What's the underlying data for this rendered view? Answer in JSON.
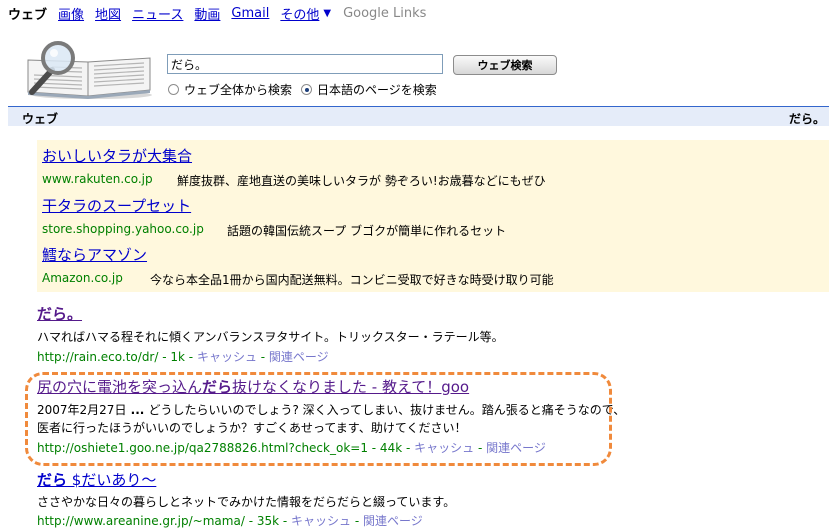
{
  "nav": {
    "items": [
      "ウェブ",
      "画像",
      "地図",
      "ニュース",
      "動画",
      "Gmail"
    ],
    "more": "その他",
    "google_links": "Google Links"
  },
  "search": {
    "query": "だら。",
    "button": "ウェブ検索",
    "radio_all": "ウェブ全体から検索",
    "radio_ja": "日本語のページを検索"
  },
  "section": {
    "label": "ウェブ",
    "right": "だら。 "
  },
  "ads": [
    {
      "title": "おいしいタラが大集合",
      "url": "www.rakuten.co.jp",
      "desc": "鮮度抜群、産地直送の美味しいタラが 勢ぞろい!お歳暮などにもぜひ"
    },
    {
      "title": "干タラのスープセット",
      "url": "store.shopping.yahoo.co.jp",
      "desc": "話題の韓国伝統スープ ブゴクが簡単に作れるセット"
    },
    {
      "title": "鱈ならアマゾン",
      "url": "Amazon.co.jp",
      "desc": "今なら本全品1冊から国内配送無料。コンビニ受取で好きな時受け取り可能"
    }
  ],
  "results": [
    {
      "title": "だら。",
      "snippet": "ハマればハマる程それに傾くアンバランスヲタサイト。トリックスター・ラテール等。",
      "url": "http://rain.eco.to/dr/",
      "size": " - 1k - ",
      "cache": "キャッシュ",
      "sep": " - ",
      "related": "関連ページ"
    },
    {
      "title_a": "尻の穴に電池を突っ込ん",
      "title_b": "だら",
      "title_c": "抜けなくなりました - 教えて！goo",
      "snippet_date": "2007年2月27日",
      "snippet_ellipsis": " ... ",
      "snippet_l1": "どうしたらいいのでしょう? 深く入ってしまい、抜けません。踏ん張ると痛そうなので、",
      "snippet_l2": "医者に行ったほうがいいのでしょうか？すごくあせってます、助けてください！",
      "url": "http://oshiete1.goo.ne.jp/qa2788826.html?check_ok=1",
      "size": " - 44k - ",
      "cache": "キャッシュ",
      "sep": " - ",
      "related": "関連ページ"
    },
    {
      "title_a": "だら",
      "title_b": " $だいあり～",
      "snippet": "ささやかな日々の暮らしとネットでみかけた情報をだらだらと綴っています。",
      "url": "http://www.areanine.gr.jp/~mama/",
      "size": " - 35k - ",
      "cache": "キャッシュ",
      "sep": " - ",
      "related": "関連ページ"
    }
  ],
  "colors": {
    "link": "#0000cc",
    "visited": "#551a8b",
    "url_green": "#008000",
    "ad_bg": "#fff8dd",
    "section_bg": "#e5ecf9",
    "highlight": "#f08a3c"
  }
}
